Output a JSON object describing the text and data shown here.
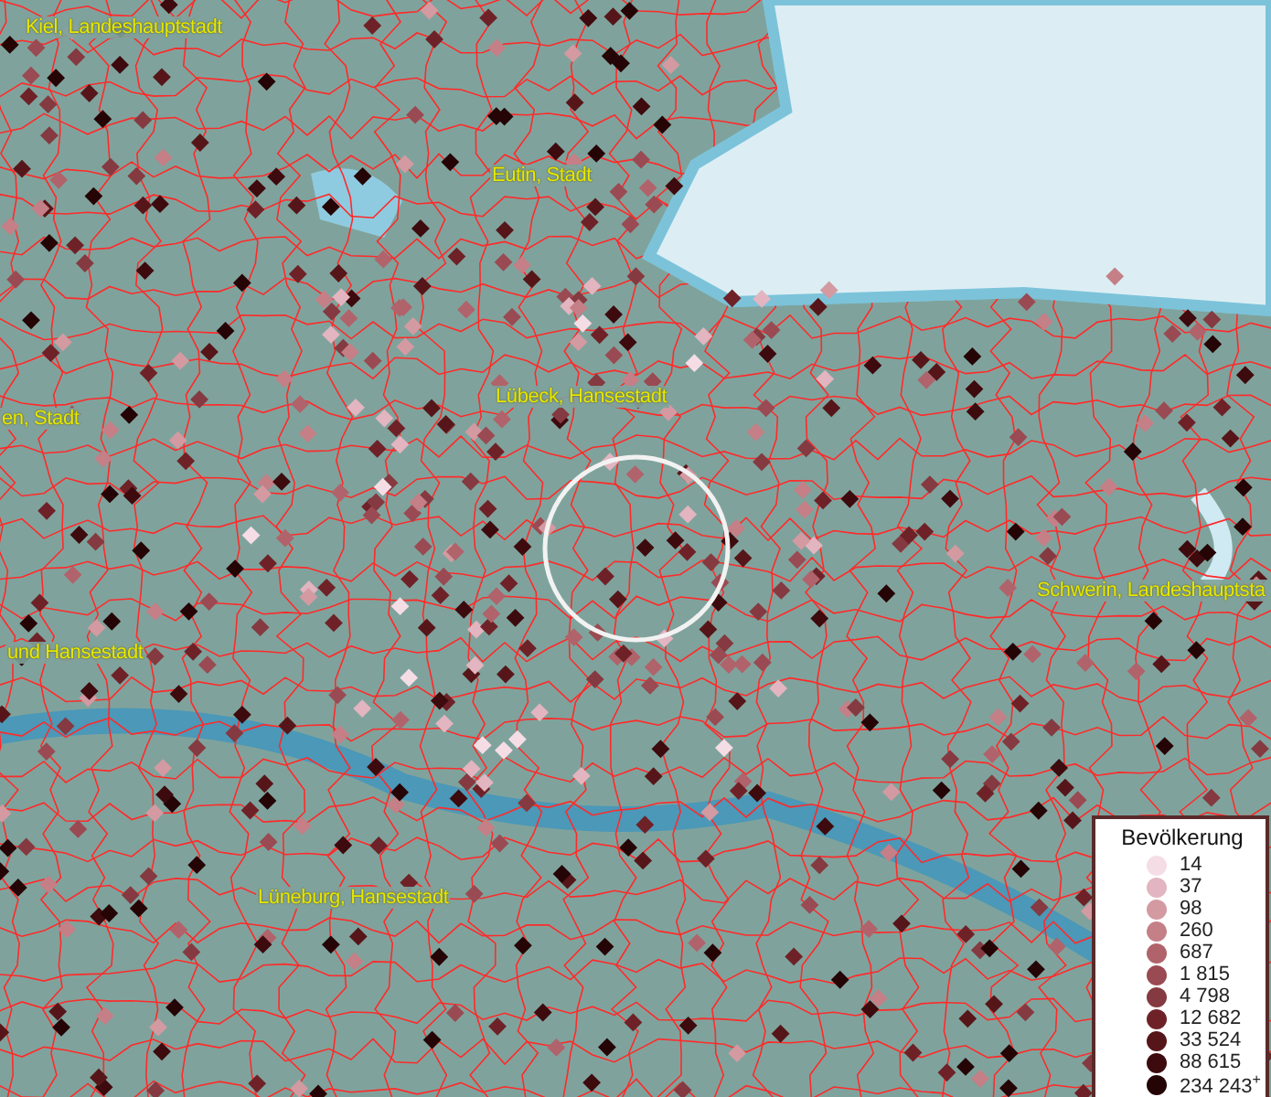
{
  "map": {
    "places": [
      {
        "label": "Kiel, Landeshauptstadt"
      },
      {
        "label": "Eutin, Stadt"
      },
      {
        "label": "Lübeck, Hansestadt"
      },
      {
        "label": "en, Stadt"
      },
      {
        "label": "und Hansestadt"
      },
      {
        "label": "Schwerin, Landeshauptsta"
      },
      {
        "label": "Lüneburg, Hansestadt"
      }
    ]
  },
  "legend": {
    "title": "Bevölkerung",
    "items": [
      {
        "label": "14",
        "color": "#f5dde6"
      },
      {
        "label": "37",
        "color": "#e2b5c0"
      },
      {
        "label": "98",
        "color": "#d39aa2"
      },
      {
        "label": "260",
        "color": "#c47f87"
      },
      {
        "label": "687",
        "color": "#b0636b"
      },
      {
        "label": "1 815",
        "color": "#9a4a52"
      },
      {
        "label": "4 798",
        "color": "#843a40"
      },
      {
        "label": "12 682",
        "color": "#6e2228"
      },
      {
        "label": "33 524",
        "color": "#561619"
      },
      {
        "label": "88 615",
        "color": "#3d0a0e"
      },
      {
        "label": "234 243$^{+}$",
        "color": "#250406"
      }
    ]
  }
}
